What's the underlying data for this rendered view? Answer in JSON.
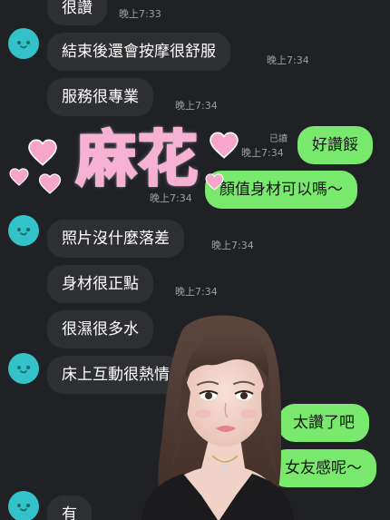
{
  "chat": {
    "messages": [
      {
        "text": "很讚",
        "time": "晚上7:33"
      },
      {
        "text": "結束後還會按摩很舒服",
        "time": "晚上7:34"
      },
      {
        "text": "服務很專業",
        "time": "晚上7:34"
      },
      {
        "text": "好讚餒",
        "read": "已讀",
        "time": "晚上7:34"
      },
      {
        "text": "顏值身材可以嗎～",
        "time": "晚上7:34"
      },
      {
        "text": "照片沒什麼落差",
        "time": "晚上7:34"
      },
      {
        "text": "身材很正點",
        "time": "晚上7:34"
      },
      {
        "text": "很濕很多水"
      },
      {
        "text": "床上互動很熱情"
      },
      {
        "text": "太讚了吧"
      },
      {
        "text": "女友感呢～"
      },
      {
        "text": "有"
      }
    ]
  },
  "overlay": {
    "title": "麻花",
    "heart_color": "#f6a6c9",
    "photo_name": "profile-photo"
  },
  "colors": {
    "background": "#202125",
    "incoming_bubble": "#2e2f33",
    "outgoing_bubble": "#79e96d",
    "avatar": "#33c2c9",
    "timestamp": "#9c9ea4"
  }
}
